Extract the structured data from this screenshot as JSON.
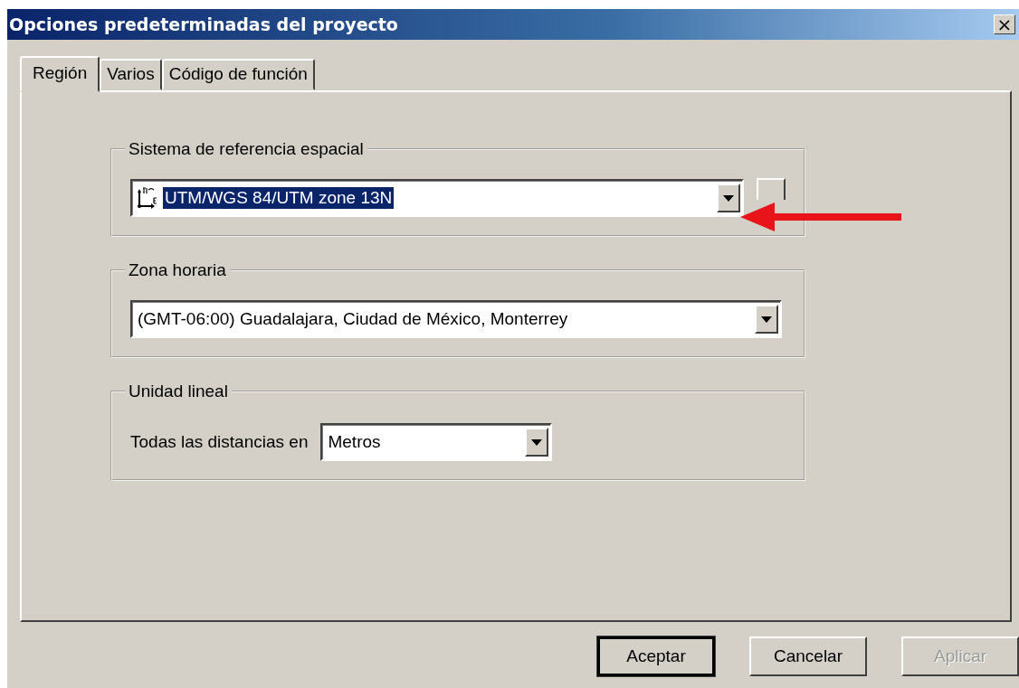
{
  "window": {
    "title": "Opciones predeterminadas del proyecto",
    "close": "×"
  },
  "tabs": [
    {
      "label": "Región",
      "selected": true
    },
    {
      "label": "Varios",
      "selected": false
    },
    {
      "label": "Código de función",
      "selected": false
    }
  ],
  "groups": [
    {
      "kind": "reference",
      "title": "Sistema de referencia espacial",
      "value": "UTM/WGS 84/UTM zone 13N",
      "highlighted": true
    },
    {
      "kind": "combo",
      "title": "Zona horaria",
      "value": "(GMT-06:00) Guadalajara, Ciudad de México, Monterrey",
      "highlighted": false
    },
    {
      "kind": "labeled",
      "title": "Unidad lineal",
      "label": "Todas las distancias en",
      "value": "Metros",
      "highlighted": false
    }
  ],
  "buttons": [
    {
      "label": "Aceptar",
      "default": true,
      "disabled": false
    },
    {
      "label": "Cancelar",
      "default": false,
      "disabled": false
    },
    {
      "label": "Aplicar",
      "default": false,
      "disabled": true
    }
  ]
}
